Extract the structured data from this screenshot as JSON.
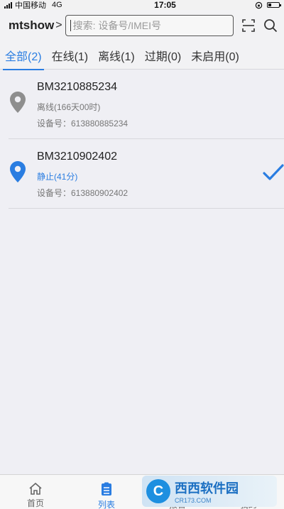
{
  "status_bar": {
    "carrier": "中国移动",
    "network": "4G",
    "time": "17:05"
  },
  "header": {
    "account": "mtshow",
    "search_placeholder": "搜索: 设备号/IMEI号"
  },
  "tabs": [
    {
      "label": "全部(2)",
      "active": true
    },
    {
      "label": "在线(1)",
      "active": false
    },
    {
      "label": "离线(1)",
      "active": false
    },
    {
      "label": "过期(0)",
      "active": false
    },
    {
      "label": "未启用(0)",
      "active": false
    }
  ],
  "devices": [
    {
      "name": "BM3210885234",
      "status": "离线(166天00时)",
      "imei": "设备号：613880885234",
      "selected": false
    },
    {
      "name": "BM3210902402",
      "status": "静止(41分)",
      "imei": "设备号：613880902402",
      "selected": true
    }
  ],
  "bottom_nav": [
    {
      "label": "首页",
      "icon": "home-icon"
    },
    {
      "label": "列表",
      "icon": "list-icon"
    },
    {
      "label": "报警",
      "icon": "alarm-icon"
    },
    {
      "label": "我的",
      "icon": "profile-icon"
    }
  ],
  "watermark": {
    "main": "西西软件园",
    "sub": "CR173.COM"
  },
  "colors": {
    "accent": "#2a7de1",
    "offline_pin": "#8e8e8e",
    "background": "#efeff4"
  }
}
